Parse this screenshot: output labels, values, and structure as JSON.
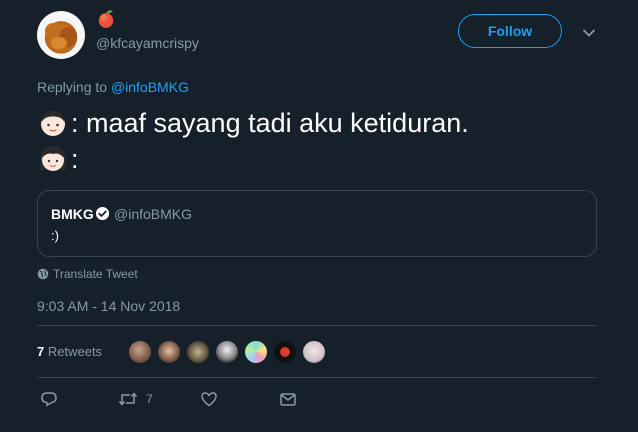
{
  "author": {
    "avatar_icon": "fried-chicken-avatar",
    "name_emoji": "mango-emoji",
    "handle": "@kfcayamcrispy"
  },
  "follow": {
    "label": "Follow",
    "accent_color": "#1da1f2"
  },
  "reply_context": {
    "prefix": "Replying to",
    "mention": "@infoBMKG"
  },
  "tweet": {
    "line1_icon": "boy-face-emoji",
    "line1_text": ": maaf sayang tadi aku ketiduran.",
    "line2_icon": "girl-face-emoji",
    "line2_text": ":"
  },
  "quoted_tweet": {
    "name": "BMKG",
    "verified_icon": "verified-badge-icon",
    "handle": "@infoBMKG",
    "text": ":)"
  },
  "translate": {
    "icon": "globe-icon",
    "label": "Translate Tweet"
  },
  "timestamp": "9:03 AM - 14 Nov 2018",
  "stats": {
    "retweets_count": "7",
    "retweets_label": "Retweets"
  },
  "actions": {
    "reply_icon": "reply-icon",
    "retweet_icon": "retweet-icon",
    "retweet_count": "7",
    "like_icon": "heart-icon",
    "dm_icon": "envelope-icon"
  },
  "colors": {
    "background": "#15202b",
    "secondary_text": "#8899a6",
    "border": "#38444d",
    "accent": "#1da1f2"
  }
}
